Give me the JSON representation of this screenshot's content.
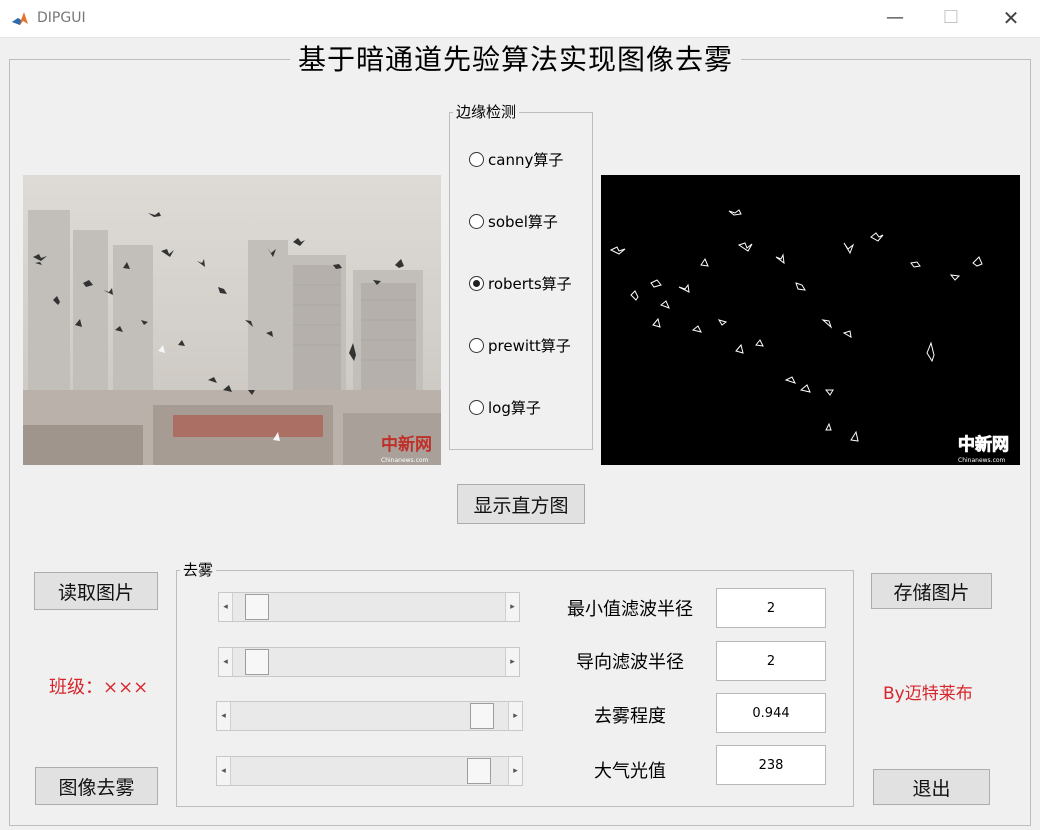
{
  "window": {
    "title": "DIPGUI",
    "minimize_glyph": "—",
    "maximize_glyph": "☐",
    "close_glyph": "✕",
    "icon": "matlab-logo-icon"
  },
  "main": {
    "title": "基于暗通道先验算法实现图像去雾"
  },
  "edge_detection": {
    "legend": "边缘检测",
    "options": [
      {
        "label": "canny算子",
        "checked": false
      },
      {
        "label": "sobel算子",
        "checked": false
      },
      {
        "label": "roberts算子",
        "checked": true
      },
      {
        "label": "prewitt算子",
        "checked": false
      },
      {
        "label": "log算子",
        "checked": false
      }
    ]
  },
  "images": {
    "watermark_logo": "中新网",
    "watermark_url": "Chinanews.com"
  },
  "buttons": {
    "histogram": "显示直方图",
    "read_image": "读取图片",
    "dehaze_image": "图像去雾",
    "save_image": "存储图片",
    "exit": "退出"
  },
  "dehaze": {
    "legend": "去雾",
    "params": [
      {
        "label": "最小值滤波半径",
        "value": "2",
        "slider_fraction": 0.05
      },
      {
        "label": "导向滤波半径",
        "value": "2",
        "slider_fraction": 0.05
      },
      {
        "label": "去雾程度",
        "value": "0.944",
        "slider_fraction": 0.944
      },
      {
        "label": "大气光值",
        "value": "238",
        "slider_fraction": 0.933
      }
    ]
  },
  "info": {
    "class_label": "班级：×××",
    "author": "By迈特莱布"
  },
  "colors": {
    "accent_red": "#d6262c",
    "window_bg": "#f0f0f0",
    "button_bg": "#e1e1e1"
  }
}
